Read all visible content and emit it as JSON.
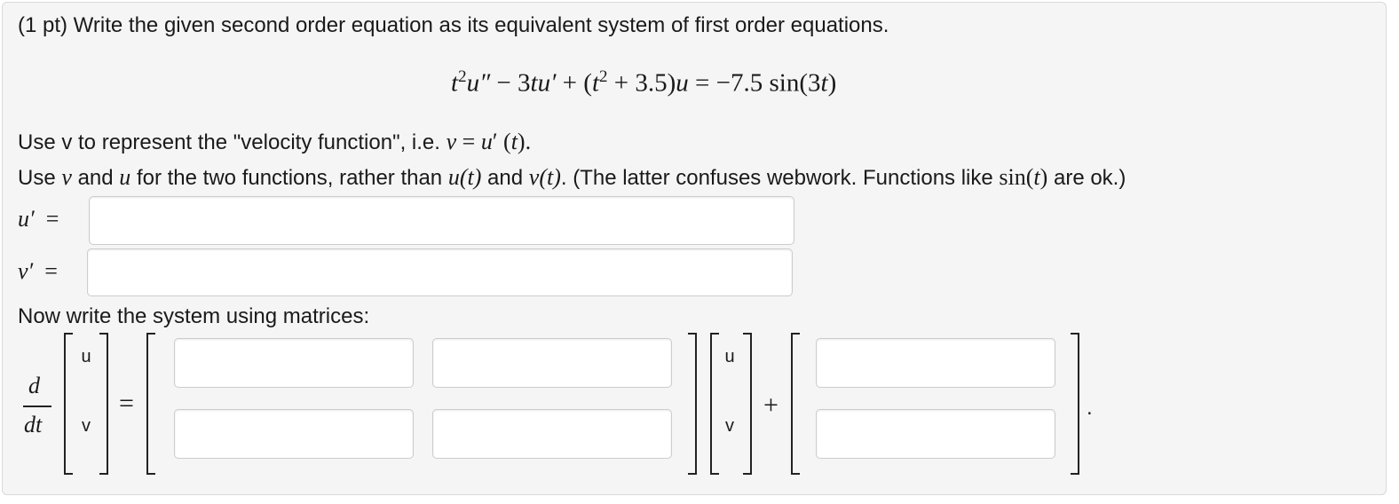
{
  "problem": {
    "header": "(1 pt) Write the given second order equation as its equivalent system of first order equations.",
    "equation": {
      "t": "t",
      "sq": "2",
      "u2": "u″",
      "minus": "−",
      "term2": "3",
      "tu": "tu′",
      "plus": "+",
      "paren_open": "(",
      "plus_num": "+ 3.5)",
      "u": "u",
      "rhs": "= −7.5 sin(3",
      "rhs_t": "t",
      "rhs_close": ")"
    },
    "instruction1": {
      "text": "Use v to represent the \"velocity function\", i.e. ",
      "v": "v",
      "eq": " = ",
      "u": "u",
      "prime": "′",
      "t_open": " (",
      "t": "t",
      "t_close": ")."
    },
    "instruction2": {
      "a": "Use ",
      "v": "v",
      "b": " and ",
      "u": "u",
      "c": " for the two functions, rather than ",
      "ut_u": "u",
      "ut_rest": "(t)",
      "d": " and ",
      "vt_v": "v",
      "vt_rest": "(t)",
      "e": ". (The latter confuses webwork. Functions like ",
      "sin": "sin(",
      "sin_t": "t",
      "sin_close": ")",
      "f": " are ok.)"
    },
    "u_prime_label": {
      "u": "u′",
      "eq": "="
    },
    "v_prime_label": {
      "v": "v′",
      "eq": "="
    },
    "matrix_heading": "Now write the system using matrices:",
    "matrix": {
      "d": "d",
      "dt": "dt",
      "vec_u": "u",
      "vec_v": "v",
      "equals": "=",
      "plus": "+",
      "period": "."
    },
    "answers": {
      "u_prime": "",
      "v_prime": "",
      "a11": "",
      "a12": "",
      "a21": "",
      "a22": "",
      "b1": "",
      "b2": ""
    }
  },
  "colors": {
    "panel_bg": "#f5f5f5",
    "panel_border": "#d9d9d9",
    "input_border": "#cccccc"
  }
}
